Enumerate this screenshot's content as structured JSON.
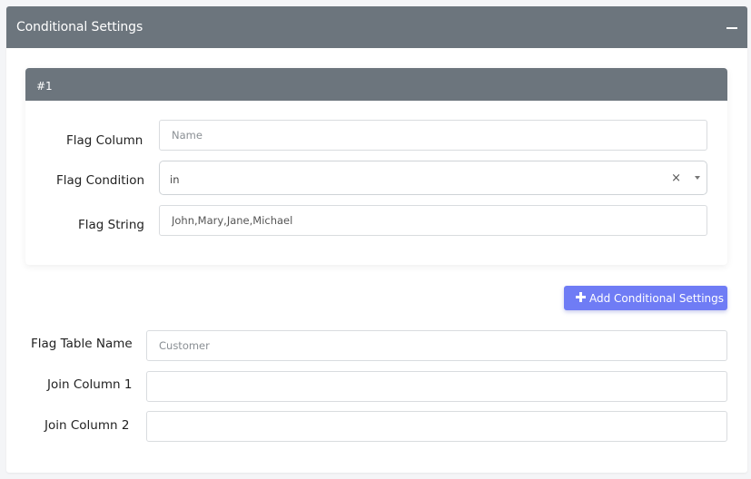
{
  "panel": {
    "title": "Conditional Settings",
    "collapse_icon": "minus-icon"
  },
  "conditions": [
    {
      "header": "#1",
      "flag_column": {
        "label": "Flag Column",
        "placeholder": "Name",
        "value": ""
      },
      "flag_condition": {
        "label": "Flag Condition",
        "value": "in",
        "clear_glyph": "×"
      },
      "flag_string": {
        "label": "Flag String",
        "value": "John,Mary,Jane,Michael"
      }
    }
  ],
  "add_button": {
    "label": "Add Conditional Settings",
    "icon": "plus-icon"
  },
  "flag_table_name": {
    "label": "Flag Table Name",
    "placeholder": "Customer",
    "value": ""
  },
  "join_column_1": {
    "label": "Join Column 1",
    "value": ""
  },
  "join_column_2": {
    "label": "Join Column 2",
    "value": ""
  },
  "colors": {
    "header_bg": "#6c757d",
    "button_bg": "#6f7cf5",
    "page_bg": "#f4f5f7"
  }
}
